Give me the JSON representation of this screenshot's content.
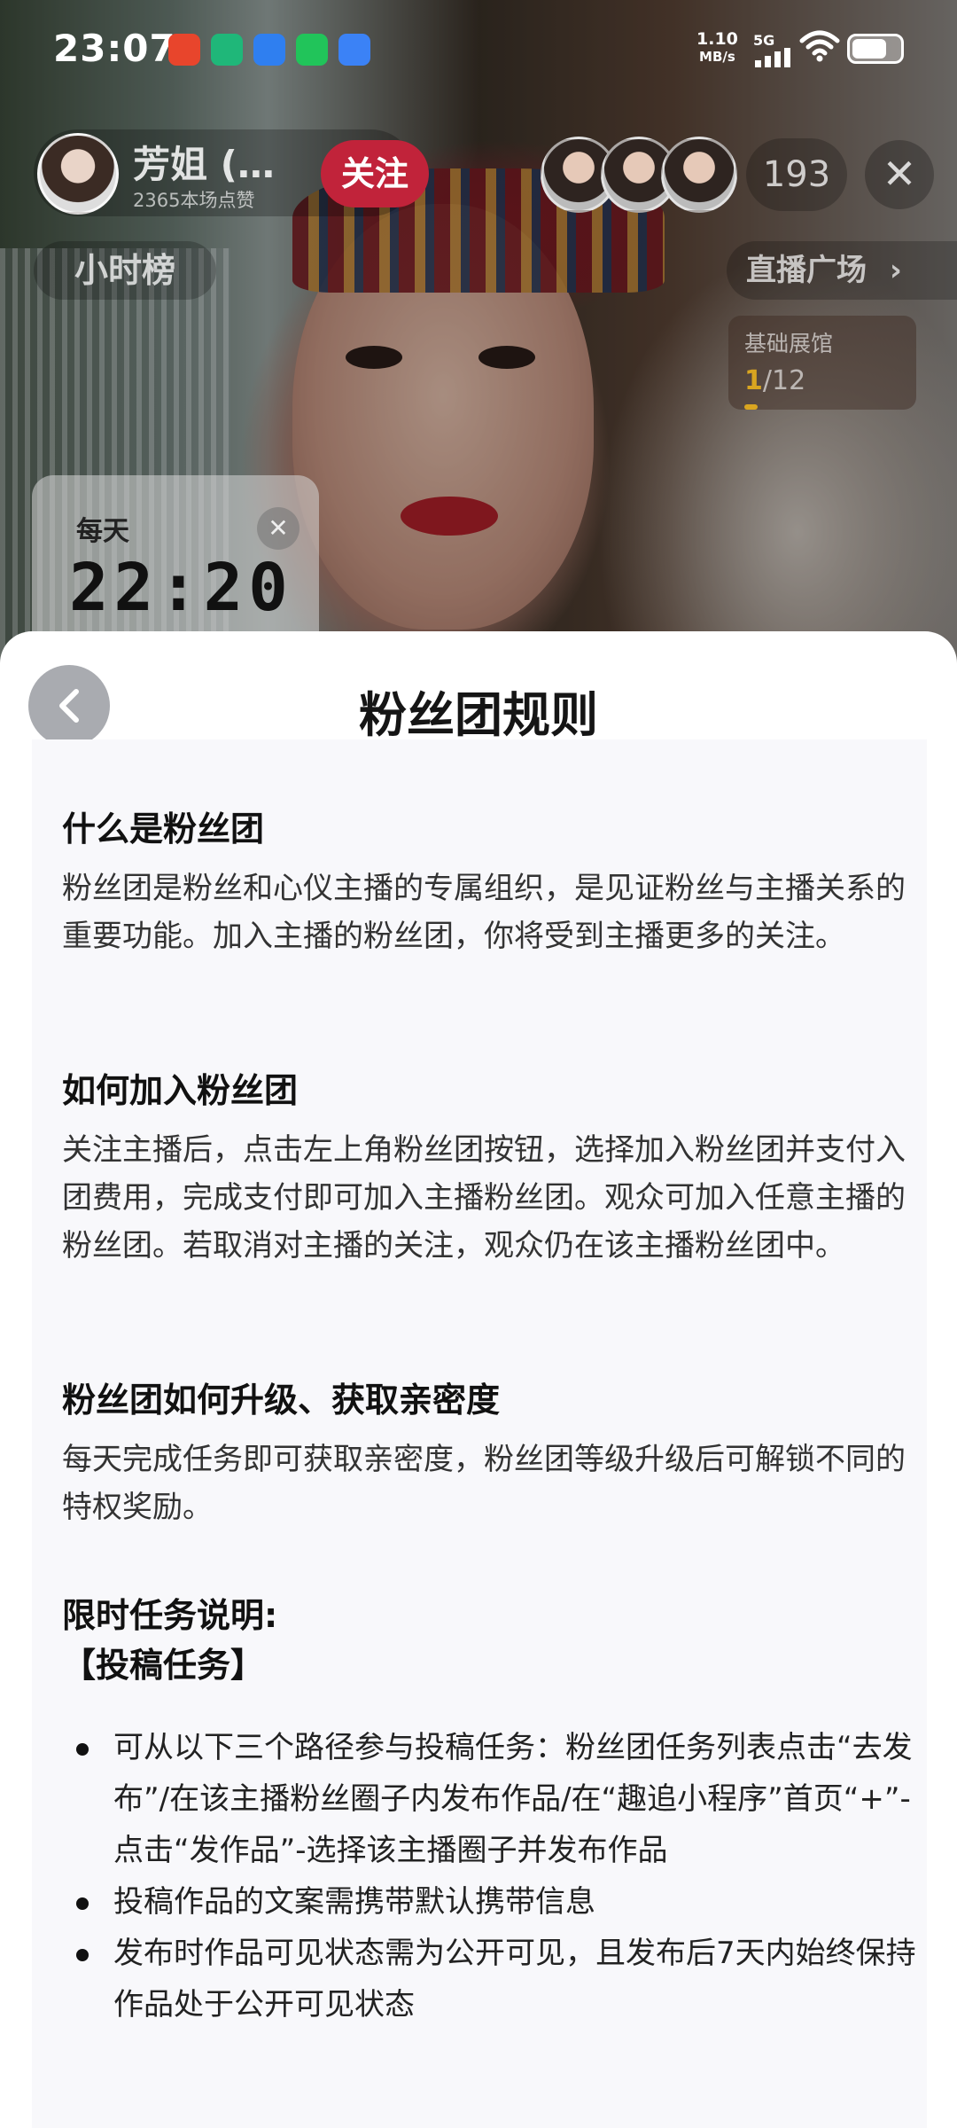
{
  "status_bar": {
    "time": "23:07",
    "net_speed_value": "1.10",
    "net_speed_unit": "MB/s",
    "network": "5G",
    "app_icons": [
      {
        "name": "app-red-icon",
        "color": "#e8452c"
      },
      {
        "name": "app-green-shield-icon",
        "color": "#1fb779"
      },
      {
        "name": "app-blue-icon",
        "color": "#2f7ff0"
      },
      {
        "name": "app-phone-icon",
        "color": "#21c45a"
      },
      {
        "name": "app-blue-note-icon",
        "color": "#3b82f6"
      }
    ]
  },
  "live": {
    "host_name": "芳姐 (…",
    "host_likes": "2365本场点赞",
    "follow_label": "关注",
    "viewer_count": "193",
    "close_symbol": "✕",
    "hour_rank_label": "小时榜",
    "plaza_label": "直播广场",
    "exhibit_title": "基础展馆",
    "exhibit_current": "1",
    "exhibit_total": "/12",
    "exhibit_progress": 0.083,
    "timer_label": "每天",
    "timer_value": "22:20",
    "timer_close": "✕"
  },
  "sheet": {
    "title": "粉丝团规则",
    "sections": [
      {
        "heading": "什么是粉丝团",
        "body": "粉丝团是粉丝和心仪主播的专属组织，是见证粉丝与主播关系的重要功能。加入主播的粉丝团，你将受到主播更多的关注。"
      },
      {
        "heading": "如何加入粉丝团",
        "body": "关注主播后，点击左上角粉丝团按钮，选择加入粉丝团并支付入团费用，完成支付即可加入主播粉丝团。观众可加入任意主播的粉丝团。若取消对主播的关注，观众仍在该主播粉丝团中。"
      },
      {
        "heading": "粉丝团如何升级、获取亲密度",
        "body": "每天完成任务即可获取亲密度，粉丝团等级升级后可解锁不同的特权奖励。"
      }
    ],
    "limited_heading": "限时任务说明:",
    "task_heading": "【投稿任务】",
    "task_items": [
      "可从以下三个路径参与投稿任务：粉丝团任务列表点击“去发布”/在该主播粉丝圈子内发布作品/在“趣追小程序”首页“+”-点击“发作品”-选择该主播圈子并发布作品",
      "投稿作品的文案需携带默认携带信息",
      "发布时作品可见状态需为公开可见，且发布后7天内始终保持作品处于公开可见状态"
    ]
  }
}
